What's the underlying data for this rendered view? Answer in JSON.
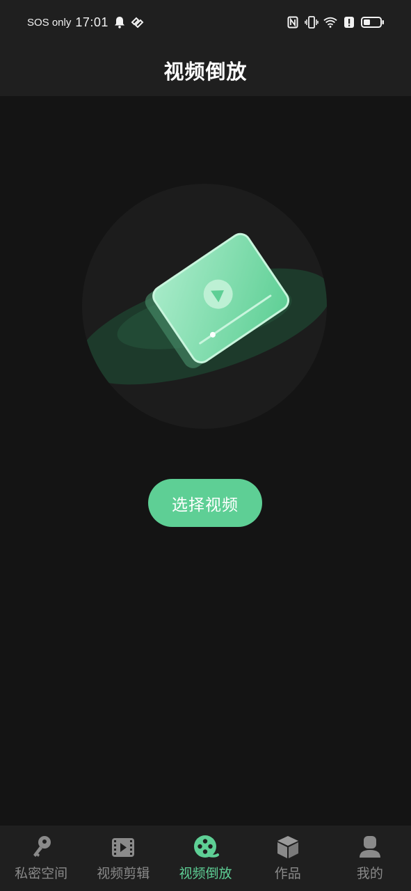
{
  "status_bar": {
    "carrier": "SOS only",
    "time": "17:01"
  },
  "header": {
    "title": "视频倒放"
  },
  "main": {
    "select_button_label": "选择视频"
  },
  "bottom_nav": {
    "active_index": 2,
    "items": [
      {
        "label": "私密空间",
        "icon": "key-icon"
      },
      {
        "label": "视频剪辑",
        "icon": "film-icon"
      },
      {
        "label": "视频倒放",
        "icon": "reel-icon"
      },
      {
        "label": "作品",
        "icon": "cube-icon"
      },
      {
        "label": "我的",
        "icon": "user-icon"
      }
    ]
  },
  "colors": {
    "accent": "#5ecf95",
    "background": "#141414",
    "bar": "#1f1f1f",
    "inactive": "#8a8a8a"
  }
}
